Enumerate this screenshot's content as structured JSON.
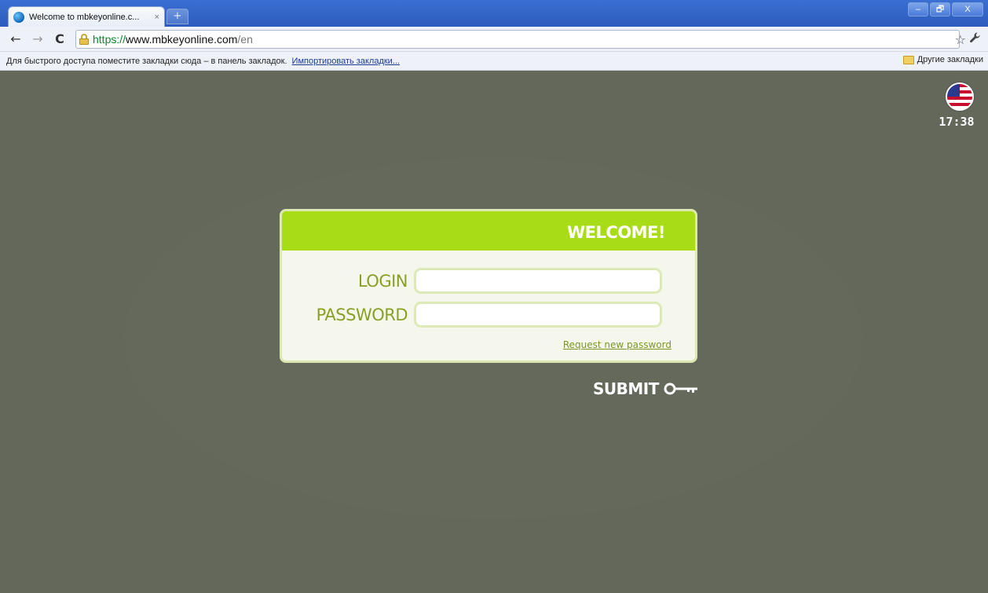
{
  "browser": {
    "tab_title": "Welcome to mbkeyonline.c...",
    "tab_close": "×",
    "new_tab": "+",
    "window_controls": {
      "minimize": "–",
      "restore": "🗗",
      "close": "X"
    },
    "nav": {
      "back": "←",
      "forward": "→",
      "reload": "C"
    },
    "url": {
      "scheme": "https://",
      "host": "www.mbkeyonline.com",
      "path": "/en"
    },
    "star": "☆",
    "wrench": "🔧",
    "bookmarks_hint": "Для быстрого доступа поместите закладки сюда – в панель закладок.",
    "bookmarks_import": "Импортировать закладки...",
    "other_bookmarks": "Другие закладки"
  },
  "page": {
    "clock": "17:38",
    "language_flag": "us-flag-icon",
    "welcome_title": "WELCOME!",
    "login_label": "LOGIN",
    "login_value": "",
    "password_label": "PASSWORD",
    "password_value": "",
    "request_password": "Request new password",
    "submit_label": "SUBMIT"
  },
  "colors": {
    "background": "#63685a",
    "header_green": "#a8dc17",
    "label_green": "#87a025",
    "panel_bg": "#f6f7ec"
  }
}
